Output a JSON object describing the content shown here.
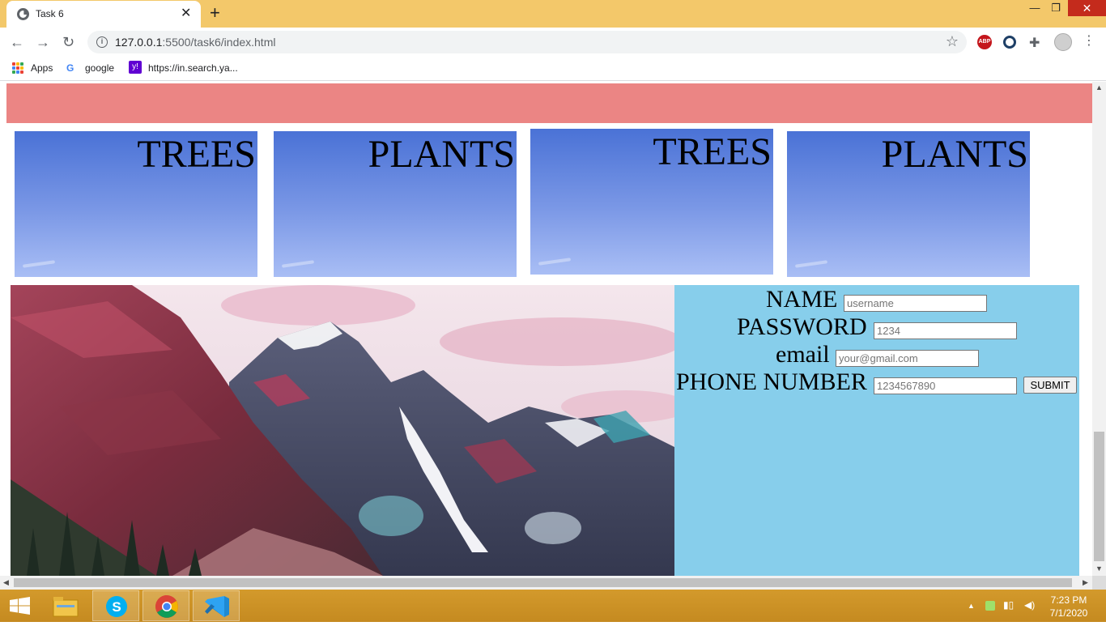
{
  "browser": {
    "tab_title": "Task 6",
    "close_tab": "✕",
    "new_tab": "+",
    "url_host": "127.0.0.1",
    "url_rest": ":5500/task6/index.html",
    "bookmarks": [
      "Apps",
      "google",
      "https://in.search.ya..."
    ],
    "window_controls": {
      "minimize": "—",
      "maximize": "❐",
      "close": "✕"
    }
  },
  "page": {
    "cards": [
      "TREES",
      "PLANTS",
      "TREES",
      "PLANTS"
    ],
    "form": {
      "name_label": "NAME",
      "name_placeholder": "username",
      "password_label": "PASSWORD",
      "password_placeholder": "1234",
      "email_label": "email",
      "email_placeholder": "your@gmail.com",
      "phone_label": "PHONE NUMBER",
      "phone_placeholder": "1234567890",
      "submit_label": "SUBMIT"
    }
  },
  "taskbar": {
    "time": "7:23 PM",
    "date": "7/1/2020"
  },
  "colors": {
    "title_bar": "#f3c86a",
    "pink_bar": "#eb8584",
    "form_panel": "#87ceeb",
    "taskbar": "#c58a20"
  }
}
